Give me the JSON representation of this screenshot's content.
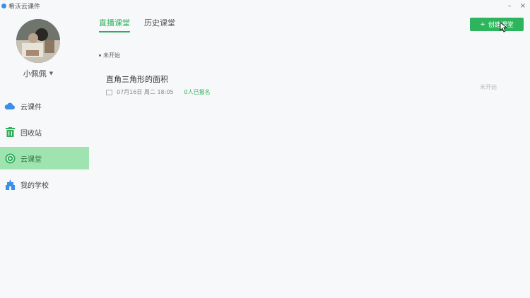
{
  "window": {
    "title": "希沃云课件",
    "minimize": "–",
    "close": "×"
  },
  "user": {
    "name": "小佩佩"
  },
  "sidebar": {
    "items": [
      {
        "label": "云课件",
        "icon": "cloud-icon"
      },
      {
        "label": "回收站",
        "icon": "trash-icon"
      },
      {
        "label": "云课堂",
        "icon": "play-icon"
      },
      {
        "label": "我的学校",
        "icon": "school-icon"
      }
    ]
  },
  "tabs": [
    {
      "label": "直播课堂",
      "active": true
    },
    {
      "label": "历史课堂",
      "active": false
    }
  ],
  "toolbar": {
    "create_label": "创建课堂"
  },
  "section": {
    "label": "未开始"
  },
  "course": {
    "title": "直角三角形的面积",
    "date": "07月16日 周二 18:05",
    "signup": "0人已报名",
    "status": "未开始"
  },
  "colors": {
    "accent": "#2db55d",
    "active_bg": "#9fe3b0"
  }
}
